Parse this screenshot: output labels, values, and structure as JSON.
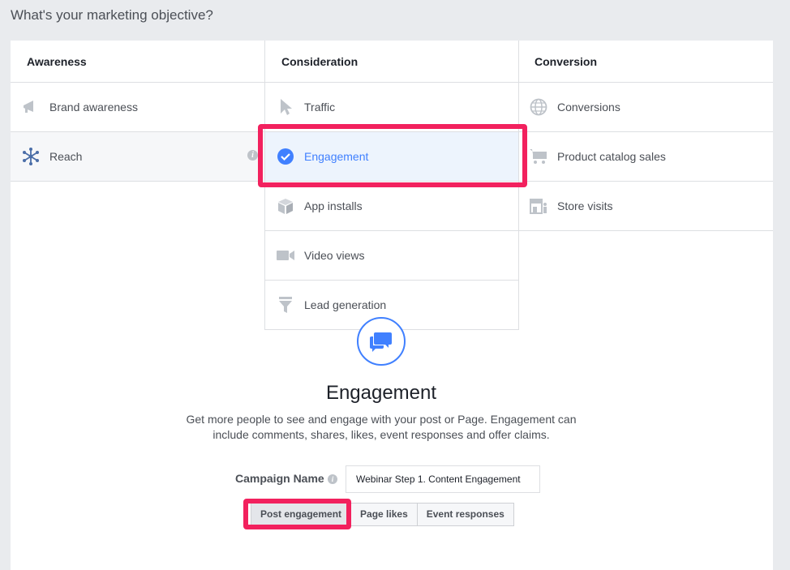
{
  "page_title": "What's your marketing objective?",
  "columns": [
    {
      "header": "Awareness",
      "items": [
        {
          "label": "Brand awareness",
          "icon": "megaphone-icon"
        },
        {
          "label": "Reach",
          "icon": "reach-icon",
          "info": "i"
        }
      ]
    },
    {
      "header": "Consideration",
      "items": [
        {
          "label": "Traffic",
          "icon": "cursor-icon"
        },
        {
          "label": "Engagement",
          "icon": "check-circle-icon"
        },
        {
          "label": "App installs",
          "icon": "box-icon"
        },
        {
          "label": "Video views",
          "icon": "video-camera-icon"
        },
        {
          "label": "Lead generation",
          "icon": "funnel-icon"
        }
      ]
    },
    {
      "header": "Conversion",
      "items": [
        {
          "label": "Conversions",
          "icon": "globe-icon"
        },
        {
          "label": "Product catalog sales",
          "icon": "cart-icon"
        },
        {
          "label": "Store visits",
          "icon": "store-icon"
        }
      ]
    }
  ],
  "detail": {
    "title": "Engagement",
    "description": "Get more people to see and engage with your post or Page. Engagement can include comments, shares, likes, event responses and offer claims.",
    "icon": "chat-bubbles-icon"
  },
  "campaign": {
    "label": "Campaign Name",
    "info": "i",
    "value": "Webinar Step 1. Content Engagement"
  },
  "engagement_types": [
    {
      "label": "Post engagement",
      "selected": true
    },
    {
      "label": "Page likes",
      "selected": false
    },
    {
      "label": "Event responses",
      "selected": false
    }
  ],
  "colors": {
    "accent": "#4080ff",
    "highlight": "#f2215e",
    "icon_gray": "#bec3c9"
  }
}
